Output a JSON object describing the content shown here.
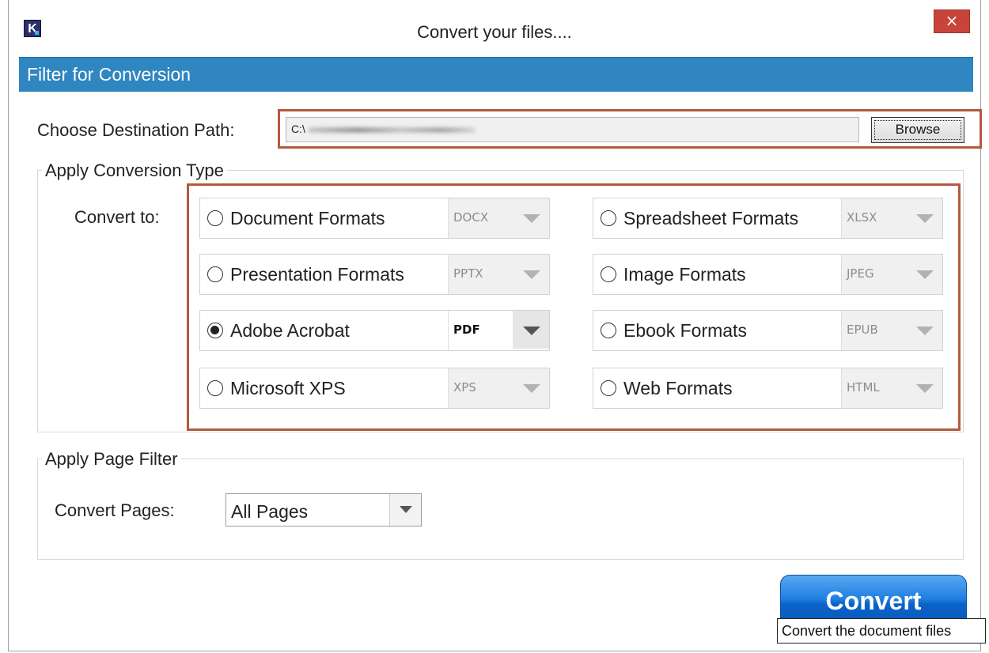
{
  "window": {
    "app_icon_letter": "K",
    "title": "Convert your files....",
    "close_symbol": "×"
  },
  "header": {
    "title": "Filter for Conversion"
  },
  "destination": {
    "label": "Choose Destination Path:",
    "path_value": "C:\\",
    "browse_label": "Browse"
  },
  "conversion": {
    "group_title": "Apply Conversion Type",
    "convert_to_label": "Convert to:",
    "options": [
      {
        "label": "Document Formats",
        "format": "DOCX",
        "selected": false
      },
      {
        "label": "Spreadsheet Formats",
        "format": "XLSX",
        "selected": false
      },
      {
        "label": "Presentation Formats",
        "format": "PPTX",
        "selected": false
      },
      {
        "label": "Image Formats",
        "format": "JPEG",
        "selected": false
      },
      {
        "label": "Adobe Acrobat",
        "format": "PDF",
        "selected": true
      },
      {
        "label": "Ebook Formats",
        "format": "EPUB",
        "selected": false
      },
      {
        "label": "Microsoft XPS",
        "format": "XPS",
        "selected": false
      },
      {
        "label": "Web Formats",
        "format": "HTML",
        "selected": false
      }
    ]
  },
  "page_filter": {
    "group_title": "Apply Page Filter",
    "label": "Convert Pages:",
    "value": "All Pages"
  },
  "actions": {
    "convert_label": "Convert",
    "tooltip": "Convert the document files"
  },
  "colors": {
    "header_band": "#2f86c0",
    "highlight_border": "#b35a3e",
    "close_button": "#c8443a",
    "convert_button": "#1f7fe0"
  }
}
